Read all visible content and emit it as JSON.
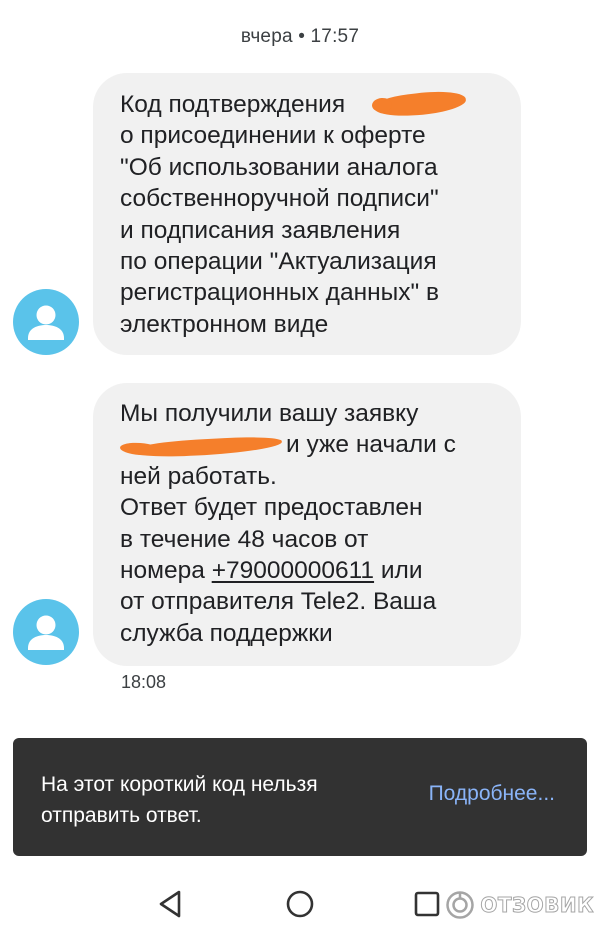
{
  "header": {
    "timestamp": "вчера • 17:57"
  },
  "messages": [
    {
      "lines": [
        "Код подтверждения",
        "о присоединении к оферте",
        "\"Об использовании аналога",
        "собственноручной подписи\"",
        "и подписания заявления",
        "по операции \"Актуализация",
        "регистрационных данных\" в",
        "электронном виде"
      ]
    },
    {
      "line1": "Мы получили вашу заявку",
      "line2": "и уже начали с",
      "line3": "ней работать.",
      "line4": "Ответ будет предоставлен",
      "line5": "в течение 48 часов от",
      "line6_prefix": "номера ",
      "phone": "+79000000611",
      "line6_suffix": " или",
      "line7": "от отправителя Tele2. Ваша",
      "line8": "служба поддержки",
      "time": "18:08"
    }
  ],
  "snackbar": {
    "text_line1": "На этот короткий код нельзя",
    "text_line2": "отправить ответ.",
    "action": "Подробнее..."
  },
  "navbar": {
    "back_icon": "triangle-back-icon",
    "home_icon": "circle-home-icon",
    "recent_icon": "square-recent-icon"
  },
  "watermark": {
    "text": "ОТЗОВИК"
  },
  "colors": {
    "avatar": "#5ac3ea",
    "bubble": "#f1f1f1",
    "snackbar": "#323232",
    "snackbar_action": "#8ab4f8",
    "redaction": "#f57f2b"
  }
}
